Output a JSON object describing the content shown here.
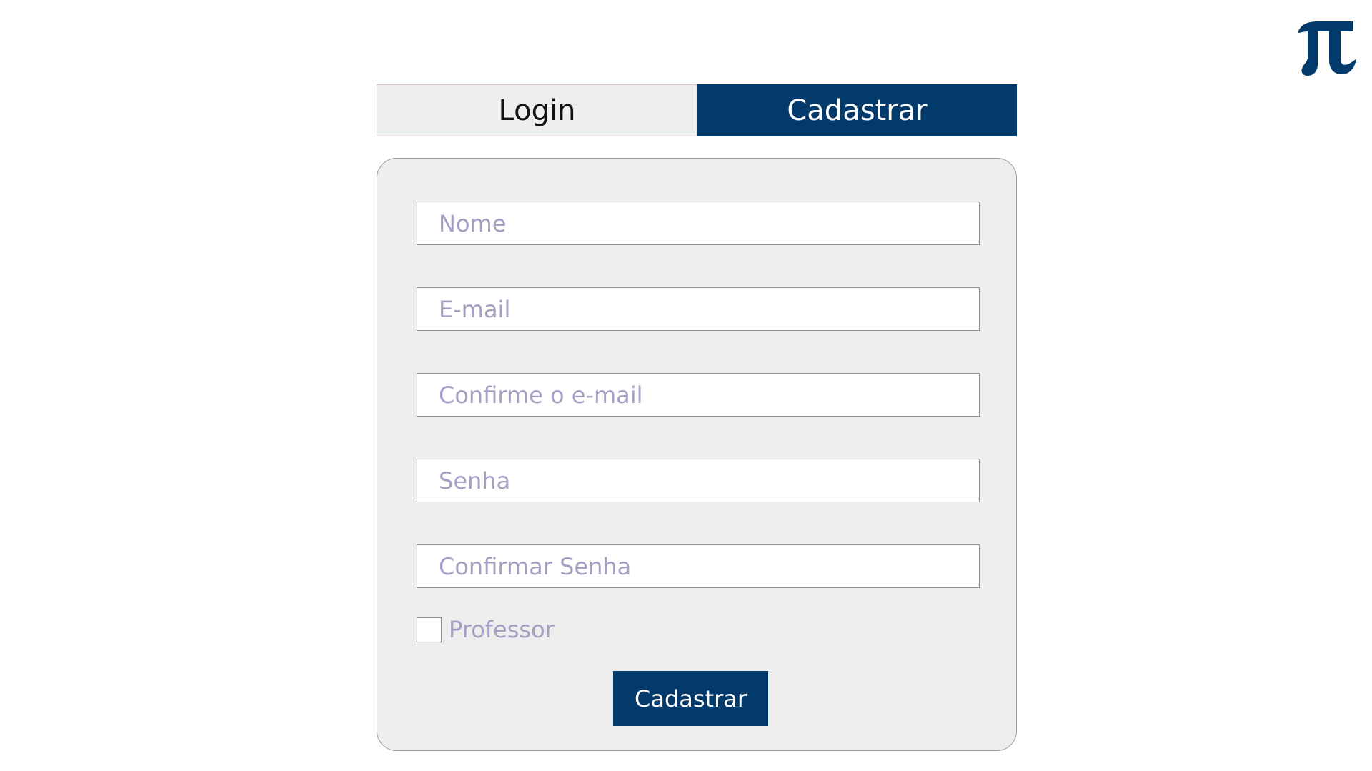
{
  "logo": {
    "icon": "pi-icon",
    "glyph": "π",
    "color": "#033a6c"
  },
  "tabs": {
    "login_label": "Login",
    "register_label": "Cadastrar",
    "active": "register"
  },
  "form": {
    "fields": {
      "name": {
        "placeholder": "Nome",
        "value": ""
      },
      "email": {
        "placeholder": "E-mail",
        "value": ""
      },
      "confirm_email": {
        "placeholder": "Confirme o e-mail",
        "value": ""
      },
      "password": {
        "placeholder": "Senha",
        "value": ""
      },
      "confirm_password": {
        "placeholder": "Confirmar Senha",
        "value": ""
      }
    },
    "teacher_checkbox": {
      "label": "Professor",
      "checked": false
    },
    "submit_label": "Cadastrar"
  },
  "colors": {
    "accent": "#033a6c",
    "card_background": "#eeeeee",
    "placeholder": "#a3a0c4"
  }
}
